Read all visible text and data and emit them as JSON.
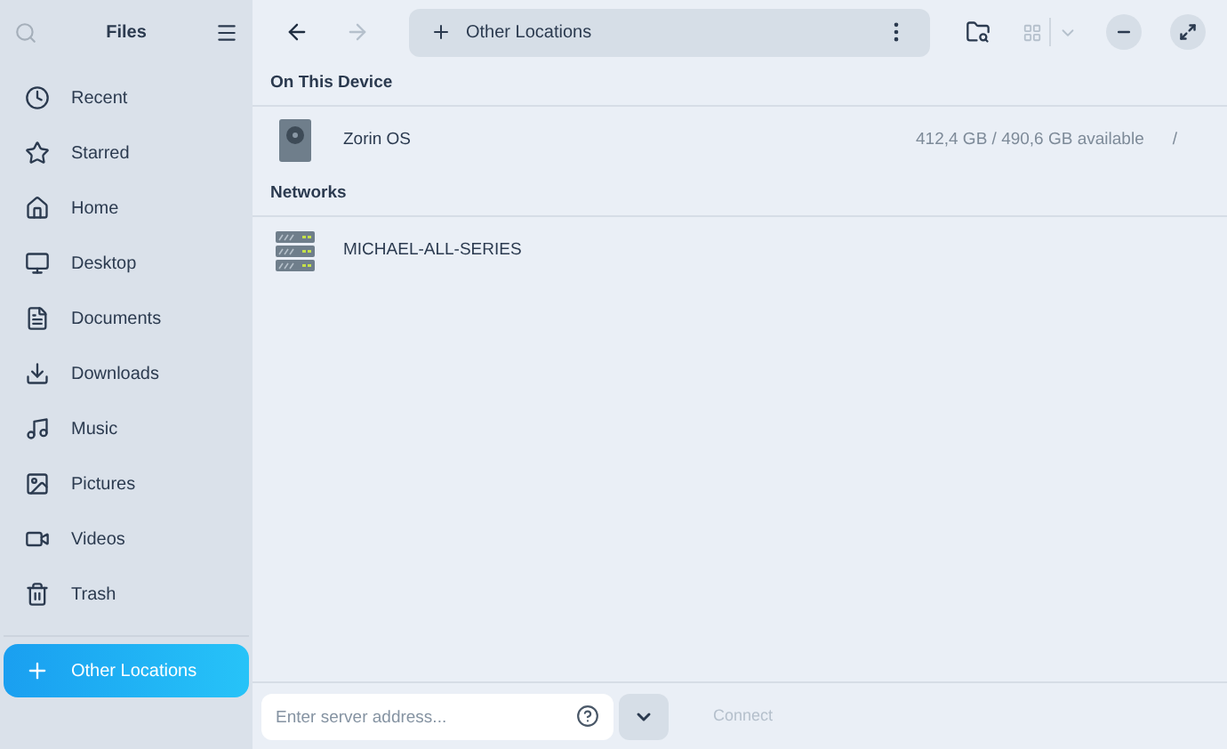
{
  "sidebar": {
    "title": "Files",
    "places": [
      {
        "label": "Recent",
        "selected": false
      },
      {
        "label": "Starred",
        "selected": false
      },
      {
        "label": "Home",
        "selected": false
      },
      {
        "label": "Desktop",
        "selected": false
      },
      {
        "label": "Documents",
        "selected": false
      },
      {
        "label": "Downloads",
        "selected": false
      },
      {
        "label": "Music",
        "selected": false
      },
      {
        "label": "Pictures",
        "selected": false
      },
      {
        "label": "Videos",
        "selected": false
      },
      {
        "label": "Trash",
        "selected": false
      }
    ],
    "other": [
      {
        "label": "Other Locations",
        "selected": true
      }
    ]
  },
  "toolbar": {
    "back": {
      "disabled": false
    },
    "forward": {
      "disabled": true
    },
    "location": "Other Locations"
  },
  "sections": [
    {
      "title": "On This Device",
      "items": [
        {
          "kind": "drive",
          "name": "Zorin OS",
          "info": "412,4 GB / 490,6 GB available",
          "path": "/"
        }
      ]
    },
    {
      "title": "Networks",
      "items": [
        {
          "kind": "server",
          "name": "MICHAEL-ALL-SERIES"
        }
      ]
    }
  ],
  "bottom": {
    "placeholder": "Enter server address...",
    "connect": {
      "label": "Connect",
      "disabled": true
    }
  }
}
